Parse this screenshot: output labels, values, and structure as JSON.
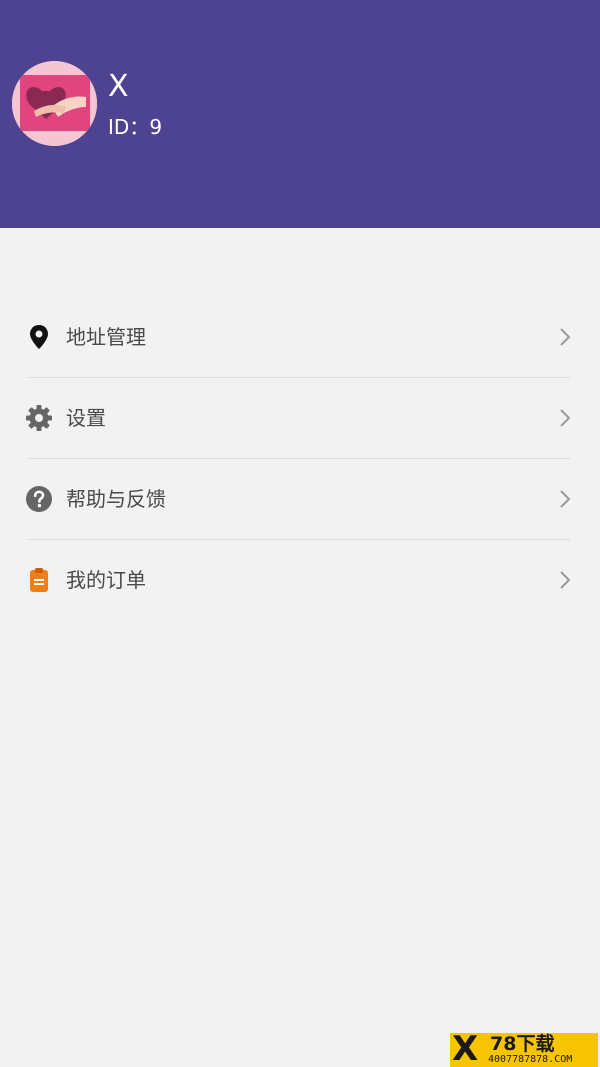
{
  "colors": {
    "header_bg": "#4e4390",
    "page_bg": "#f2f2f2",
    "order_icon": "#f07f1a",
    "watermark_bg": "#f6c400"
  },
  "profile": {
    "name": "X",
    "id_label": "ID：",
    "id_value": "9",
    "avatar_icon": "hands-heart-photo"
  },
  "menu": {
    "items": [
      {
        "label": "地址管理",
        "icon": "location-pin-icon"
      },
      {
        "label": "设置",
        "icon": "gear-icon"
      },
      {
        "label": "帮助与反馈",
        "icon": "question-circle-icon"
      },
      {
        "label": "我的订单",
        "icon": "clipboard-icon"
      }
    ]
  },
  "watermark": {
    "logo_letter": "X",
    "brand": "78下载",
    "url": "4007787878.COM"
  }
}
